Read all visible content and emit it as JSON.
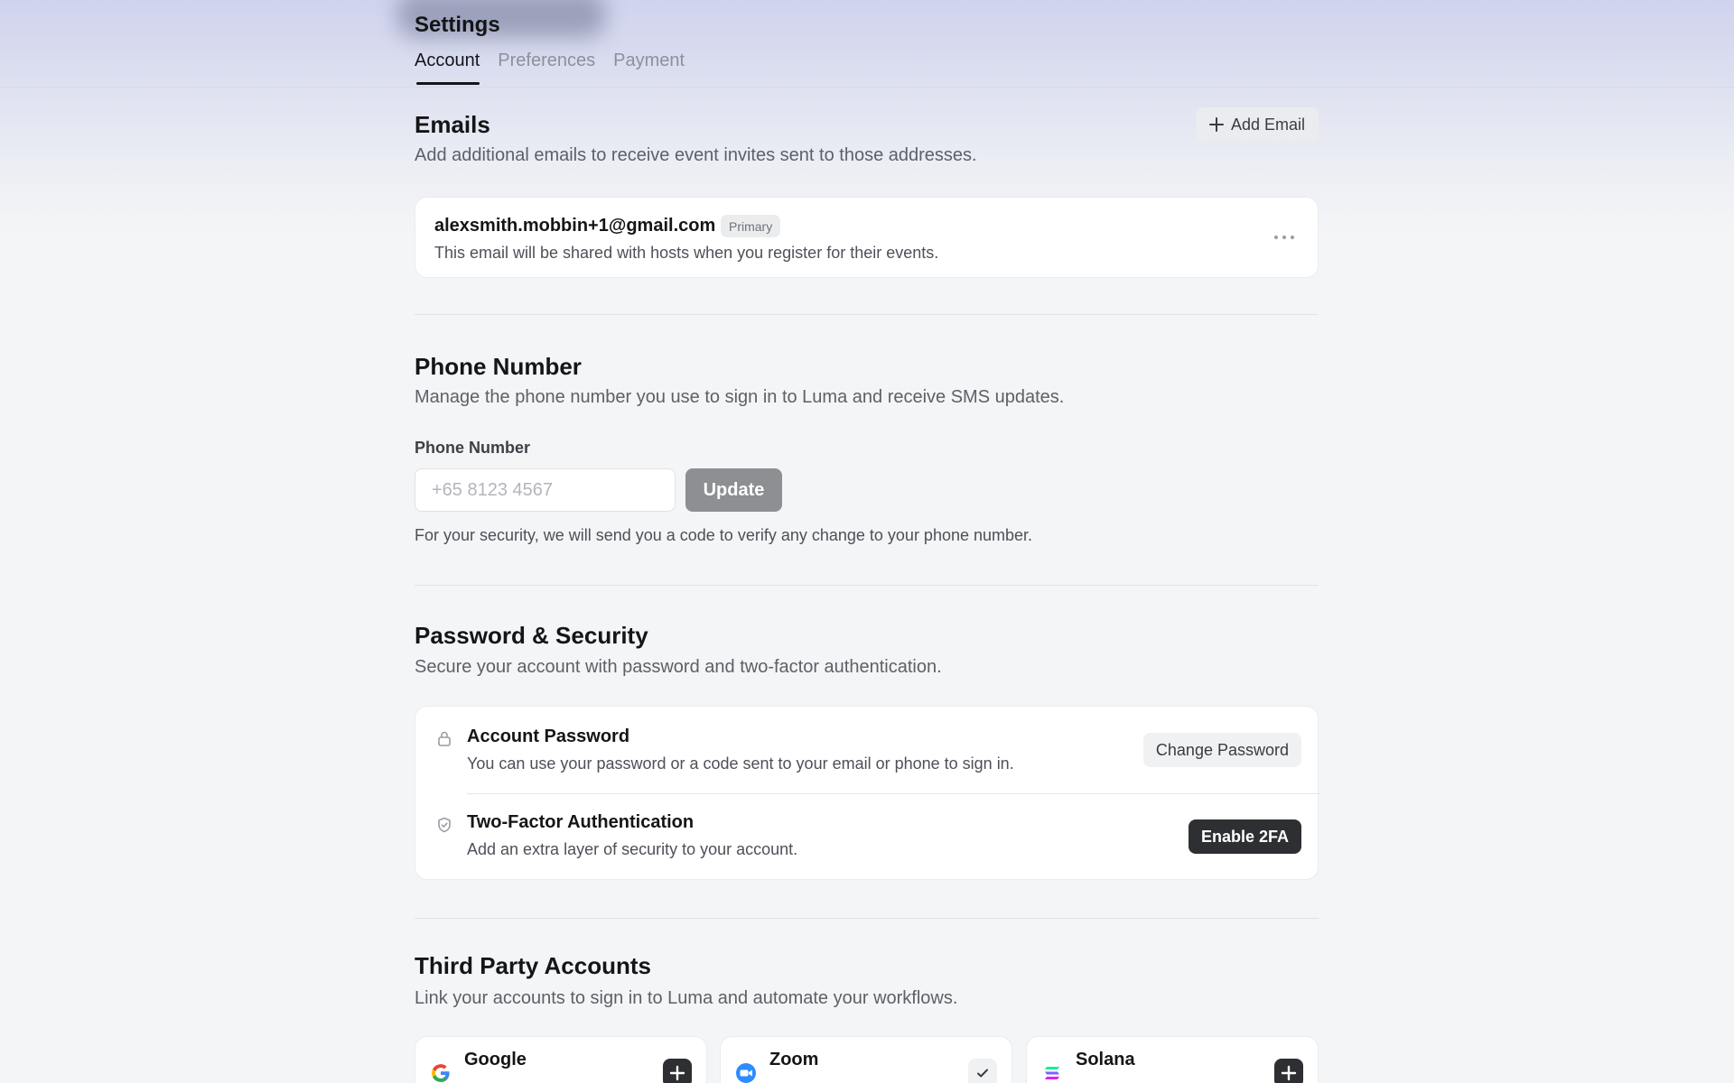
{
  "header": {
    "title": "Settings",
    "tabs": [
      {
        "label": "Account",
        "active": true
      },
      {
        "label": "Preferences",
        "active": false
      },
      {
        "label": "Payment",
        "active": false
      }
    ]
  },
  "emails": {
    "title": "Emails",
    "description": "Add additional emails to receive event invites sent to those addresses.",
    "add_button": "Add Email",
    "items": [
      {
        "address": "alexsmith.mobbin+1@gmail.com",
        "badge": "Primary",
        "note": "This email will be shared with hosts when you register for their events."
      }
    ]
  },
  "phone": {
    "title": "Phone Number",
    "description": "Manage the phone number you use to sign in to Luma and receive SMS updates.",
    "field_label": "Phone Number",
    "placeholder": "+65 8123 4567",
    "update_button": "Update",
    "help": "For your security, we will send you a code to verify any change to your phone number."
  },
  "security": {
    "title": "Password & Security",
    "description": "Secure your account with password and two-factor authentication.",
    "rows": [
      {
        "title": "Account Password",
        "subtitle": "You can use your password or a code sent to your email or phone to sign in.",
        "action": "Change Password",
        "icon": "lock-icon"
      },
      {
        "title": "Two-Factor Authentication",
        "subtitle": "Add an extra layer of security to your account.",
        "action": "Enable 2FA",
        "icon": "shield-icon"
      }
    ]
  },
  "third_party": {
    "title": "Third Party Accounts",
    "description": "Link your accounts to sign in to Luma and automate your workflows.",
    "accounts": [
      {
        "name": "Google",
        "icon": "google-icon",
        "state": "add"
      },
      {
        "name": "Zoom",
        "icon": "zoom-icon",
        "state": "connected"
      },
      {
        "name": "Solana",
        "icon": "solana-icon",
        "state": "add"
      }
    ]
  },
  "colors": {
    "accent_dark": "#2d2f33",
    "muted_button": "#8e8f93",
    "header_gradient": "#cfd3ee"
  }
}
